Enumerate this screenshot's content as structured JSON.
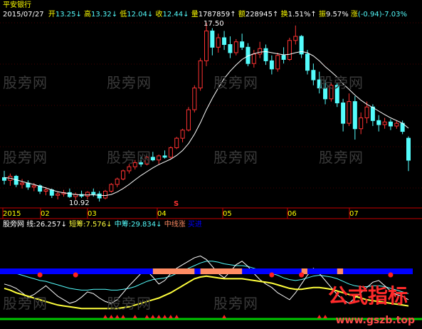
{
  "stock": {
    "name": "平安银行",
    "date": "2015/07/27",
    "open_label": "开",
    "open": "13.25",
    "high_label": "高",
    "high": "13.32",
    "low_label": "低",
    "low": "12.04",
    "close_label": "收",
    "close": "12.44",
    "volume_label": "量",
    "volume": "1787859",
    "amount_label": "额",
    "amount": "228945",
    "turnover_label": "换",
    "turnover": "1.51%",
    "amplitude_label": "振",
    "amplitude": "9.57%",
    "change_label": "涨",
    "change": "(-0.94)-7.03%",
    "down_arrow": "↓",
    "up_arrow": "↑"
  },
  "annotations": {
    "high_marker": "17.50",
    "low_marker": "10.92",
    "s_marker": "S"
  },
  "time_axis": [
    "2015",
    "02",
    "03",
    "04",
    "05",
    "06",
    "07"
  ],
  "indicator": {
    "title": "股旁网",
    "line_label": "线:",
    "line_value": "26.257",
    "short_label": "短筹:",
    "short_value": "7.576",
    "mid_label": "中筹:",
    "mid_value": "29.834",
    "midline_label": "中线涨",
    "blue_tag": "买进"
  },
  "watermark": "股旁网",
  "brand": {
    "logo": "公式指标",
    "url": "www.gszb.top"
  },
  "colors": {
    "up": "#ff3232",
    "down": "#54fcfc",
    "ma": "#ffffff",
    "blue_band": "#0000ff",
    "salmon": "#ff8c64",
    "yellow": "#ffff3c",
    "grid": "#8b0000",
    "axis": "#c80000",
    "green_base": "#00c800"
  },
  "chart_data": {
    "type": "candlestick",
    "price_range": [
      10.92,
      17.5
    ],
    "months": [
      "2015",
      "02",
      "03",
      "04",
      "05",
      "06",
      "07"
    ],
    "candles_ohlc": [
      [
        11.8,
        12.05,
        11.55,
        11.7
      ],
      [
        11.7,
        11.95,
        11.5,
        11.85
      ],
      [
        11.85,
        11.9,
        11.45,
        11.55
      ],
      [
        11.55,
        11.75,
        11.4,
        11.6
      ],
      [
        11.6,
        11.7,
        11.35,
        11.45
      ],
      [
        11.45,
        11.6,
        11.3,
        11.5
      ],
      [
        11.5,
        11.55,
        11.2,
        11.3
      ],
      [
        11.3,
        11.45,
        11.15,
        11.35
      ],
      [
        11.35,
        11.4,
        11.05,
        11.15
      ],
      [
        11.15,
        11.3,
        11.0,
        11.2
      ],
      [
        11.2,
        11.35,
        11.1,
        11.25
      ],
      [
        11.25,
        11.4,
        11.05,
        11.1
      ],
      [
        11.1,
        11.25,
        10.98,
        11.18
      ],
      [
        11.18,
        11.32,
        11.05,
        11.12
      ],
      [
        11.12,
        11.3,
        11.0,
        11.26
      ],
      [
        11.26,
        11.4,
        11.1,
        11.2
      ],
      [
        11.2,
        11.3,
        10.92,
        11.05
      ],
      [
        11.05,
        11.35,
        11.0,
        11.3
      ],
      [
        11.3,
        11.6,
        11.25,
        11.55
      ],
      [
        11.55,
        11.8,
        11.45,
        11.75
      ],
      [
        11.75,
        12.1,
        11.7,
        12.05
      ],
      [
        12.05,
        12.3,
        11.95,
        12.2
      ],
      [
        12.2,
        12.45,
        12.1,
        12.35
      ],
      [
        12.35,
        12.55,
        12.2,
        12.3
      ],
      [
        12.3,
        12.6,
        12.25,
        12.55
      ],
      [
        12.55,
        12.75,
        12.4,
        12.45
      ],
      [
        12.45,
        12.65,
        12.3,
        12.6
      ],
      [
        12.6,
        12.8,
        12.5,
        12.55
      ],
      [
        12.55,
        12.95,
        12.5,
        12.9
      ],
      [
        12.9,
        13.3,
        12.85,
        13.25
      ],
      [
        13.25,
        13.6,
        13.1,
        13.55
      ],
      [
        13.55,
        14.4,
        13.5,
        14.3
      ],
      [
        14.3,
        15.2,
        14.2,
        15.1
      ],
      [
        15.1,
        16.2,
        15.0,
        16.1
      ],
      [
        16.1,
        17.5,
        15.9,
        17.2
      ],
      [
        17.2,
        17.3,
        16.3,
        16.6
      ],
      [
        16.6,
        17.1,
        16.4,
        16.95
      ],
      [
        16.95,
        17.2,
        16.5,
        16.7
      ],
      [
        16.7,
        17.0,
        16.2,
        16.4
      ],
      [
        16.4,
        16.9,
        16.3,
        16.8
      ],
      [
        16.8,
        17.1,
        16.5,
        16.6
      ],
      [
        16.6,
        16.75,
        15.9,
        16.0
      ],
      [
        16.0,
        16.5,
        15.85,
        16.35
      ],
      [
        16.35,
        16.8,
        16.2,
        16.55
      ],
      [
        16.55,
        16.7,
        15.95,
        16.1
      ],
      [
        16.1,
        16.3,
        15.6,
        15.8
      ],
      [
        15.8,
        16.4,
        15.7,
        16.3
      ],
      [
        16.3,
        16.6,
        16.0,
        16.15
      ],
      [
        16.15,
        16.95,
        16.1,
        16.85
      ],
      [
        16.85,
        17.4,
        16.7,
        17.0
      ],
      [
        17.0,
        17.05,
        16.2,
        16.35
      ],
      [
        16.35,
        16.5,
        15.6,
        15.75
      ],
      [
        15.75,
        16.0,
        15.2,
        15.4
      ],
      [
        15.4,
        15.7,
        14.9,
        15.1
      ],
      [
        15.1,
        15.4,
        14.5,
        14.7
      ],
      [
        14.7,
        15.3,
        14.6,
        15.2
      ],
      [
        15.2,
        15.3,
        14.4,
        14.55
      ],
      [
        14.55,
        14.7,
        13.5,
        13.8
      ],
      [
        13.8,
        14.9,
        13.7,
        14.6
      ],
      [
        14.6,
        14.8,
        13.2,
        13.6
      ],
      [
        13.6,
        14.2,
        13.4,
        14.0
      ],
      [
        14.0,
        14.6,
        13.8,
        14.4
      ],
      [
        14.4,
        14.5,
        13.7,
        13.9
      ],
      [
        13.9,
        14.1,
        13.5,
        13.75
      ],
      [
        13.75,
        14.0,
        13.6,
        13.85
      ],
      [
        13.85,
        13.95,
        13.55,
        13.7
      ],
      [
        13.7,
        13.9,
        13.6,
        13.8
      ],
      [
        13.8,
        13.9,
        13.4,
        13.5
      ],
      [
        13.25,
        13.32,
        12.04,
        12.44
      ]
    ],
    "ma_values": [
      11.8,
      11.78,
      11.72,
      11.66,
      11.6,
      11.55,
      11.48,
      11.42,
      11.35,
      11.28,
      11.24,
      11.21,
      11.18,
      11.16,
      11.16,
      11.17,
      11.15,
      11.14,
      11.18,
      11.27,
      11.4,
      11.55,
      11.72,
      11.88,
      12.02,
      12.16,
      12.28,
      12.38,
      12.48,
      12.62,
      12.8,
      13.05,
      13.4,
      13.82,
      14.3,
      14.72,
      15.1,
      15.45,
      15.72,
      15.95,
      16.15,
      16.28,
      16.36,
      16.42,
      16.44,
      16.4,
      16.36,
      16.32,
      16.34,
      16.4,
      16.44,
      16.4,
      16.28,
      16.1,
      15.88,
      15.7,
      15.5,
      15.25,
      15.05,
      14.84,
      14.65,
      14.5,
      14.38,
      14.25,
      14.12,
      14.0,
      13.9,
      13.8,
      13.62
    ],
    "indicator_white": [
      40,
      38,
      35,
      30,
      25,
      28,
      33,
      38,
      32,
      26,
      22,
      18,
      20,
      25,
      31,
      29,
      24,
      20,
      18,
      22,
      30,
      38,
      45,
      52,
      55,
      48,
      40,
      44,
      52,
      58,
      62,
      66,
      70,
      72,
      68,
      60,
      52,
      47,
      54,
      62,
      66,
      60,
      52,
      45,
      40,
      36,
      30,
      26,
      22,
      30,
      40,
      50,
      58,
      52,
      44,
      36,
      28,
      22,
      18,
      24,
      30,
      36,
      42,
      44,
      38,
      32,
      28,
      26,
      22
    ],
    "indicator_cyan": [
      55,
      54,
      52,
      50,
      48,
      46,
      44,
      43,
      41,
      39,
      37,
      35,
      34,
      33,
      33,
      34,
      34,
      34,
      33,
      33,
      34,
      35,
      37,
      40,
      43,
      45,
      46,
      47,
      49,
      52,
      55,
      58,
      61,
      64,
      66,
      66,
      65,
      63,
      62,
      61,
      61,
      60,
      58,
      56,
      54,
      52,
      50,
      47,
      45,
      44,
      45,
      47,
      49,
      50,
      49,
      48,
      46,
      43,
      40,
      38,
      37,
      37,
      38,
      38,
      37,
      35,
      33,
      31,
      29
    ],
    "indicator_yellow": [
      35,
      33,
      30,
      28,
      26,
      24,
      22,
      20,
      18,
      16,
      15,
      14,
      13,
      12,
      12,
      12,
      12,
      12,
      12,
      12,
      13,
      14,
      16,
      18,
      20,
      22,
      24,
      27,
      30,
      34,
      38,
      42,
      46,
      48,
      49,
      48,
      47,
      46,
      46,
      46,
      46,
      45,
      44,
      43,
      42,
      41,
      39,
      37,
      35,
      34,
      34,
      35,
      36,
      36,
      35,
      34,
      32,
      30,
      28,
      26,
      24,
      22,
      21,
      20,
      19,
      18,
      17,
      16,
      15
    ],
    "indicator_range": [
      0,
      100
    ],
    "band_salmon_ranges": [
      [
        25,
        32
      ],
      [
        33,
        40
      ],
      [
        50,
        51
      ],
      [
        56,
        57
      ]
    ],
    "band_red_dots": [
      6,
      12,
      45,
      50,
      65
    ],
    "bottom_markers": [
      17,
      18,
      19,
      20,
      22,
      24,
      25,
      26,
      27,
      28,
      29,
      37,
      53,
      54
    ]
  }
}
